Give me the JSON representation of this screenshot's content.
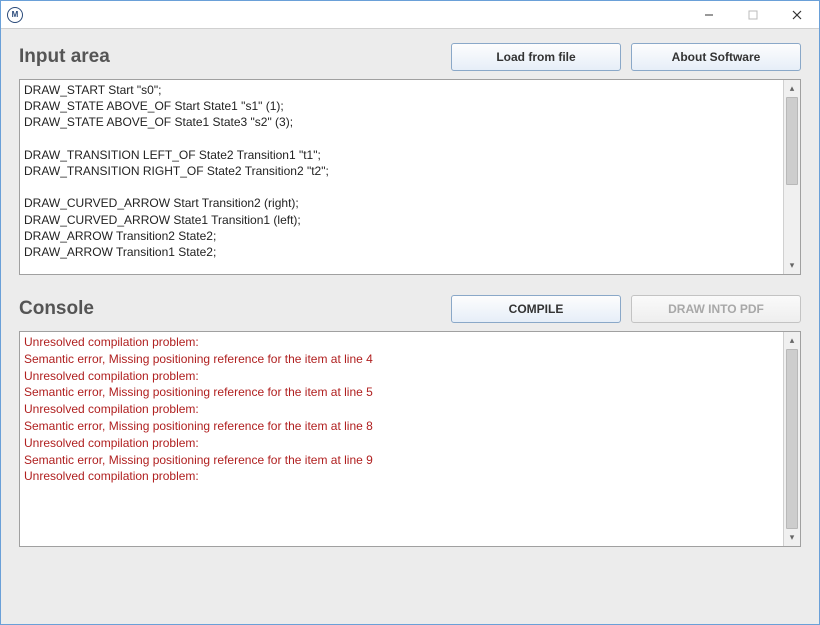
{
  "window": {
    "title": ""
  },
  "sections": {
    "input": {
      "title": "Input area",
      "buttons": {
        "load": "Load from file",
        "about": "About Software"
      },
      "code": "DRAW_START Start \"s0\";\nDRAW_STATE ABOVE_OF Start State1 \"s1\" (1);\nDRAW_STATE ABOVE_OF State1 State3 \"s2\" (3);\n\nDRAW_TRANSITION LEFT_OF State2 Transition1 \"t1\";\nDRAW_TRANSITION RIGHT_OF State2 Transition2 \"t2\";\n\nDRAW_CURVED_ARROW Start Transition2 (right);\nDRAW_CURVED_ARROW State1 Transition1 (left);\nDRAW_ARROW Transition2 State2;\nDRAW_ARROW Transition1 State2;"
    },
    "console": {
      "title": "Console",
      "buttons": {
        "compile": "COMPILE",
        "draw": "DRAW INTO PDF"
      },
      "lines": [
        "Unresolved compilation problem:",
        "Semantic error, Missing positioning reference for the item at line 4",
        "Unresolved compilation problem:",
        "Semantic error, Missing positioning reference for the item at line 5",
        "Unresolved compilation problem:",
        "Semantic error, Missing positioning reference for the item at line 8",
        "Unresolved compilation problem:",
        "Semantic error, Missing positioning reference for the item at line 9",
        "Unresolved compilation problem:"
      ]
    }
  }
}
